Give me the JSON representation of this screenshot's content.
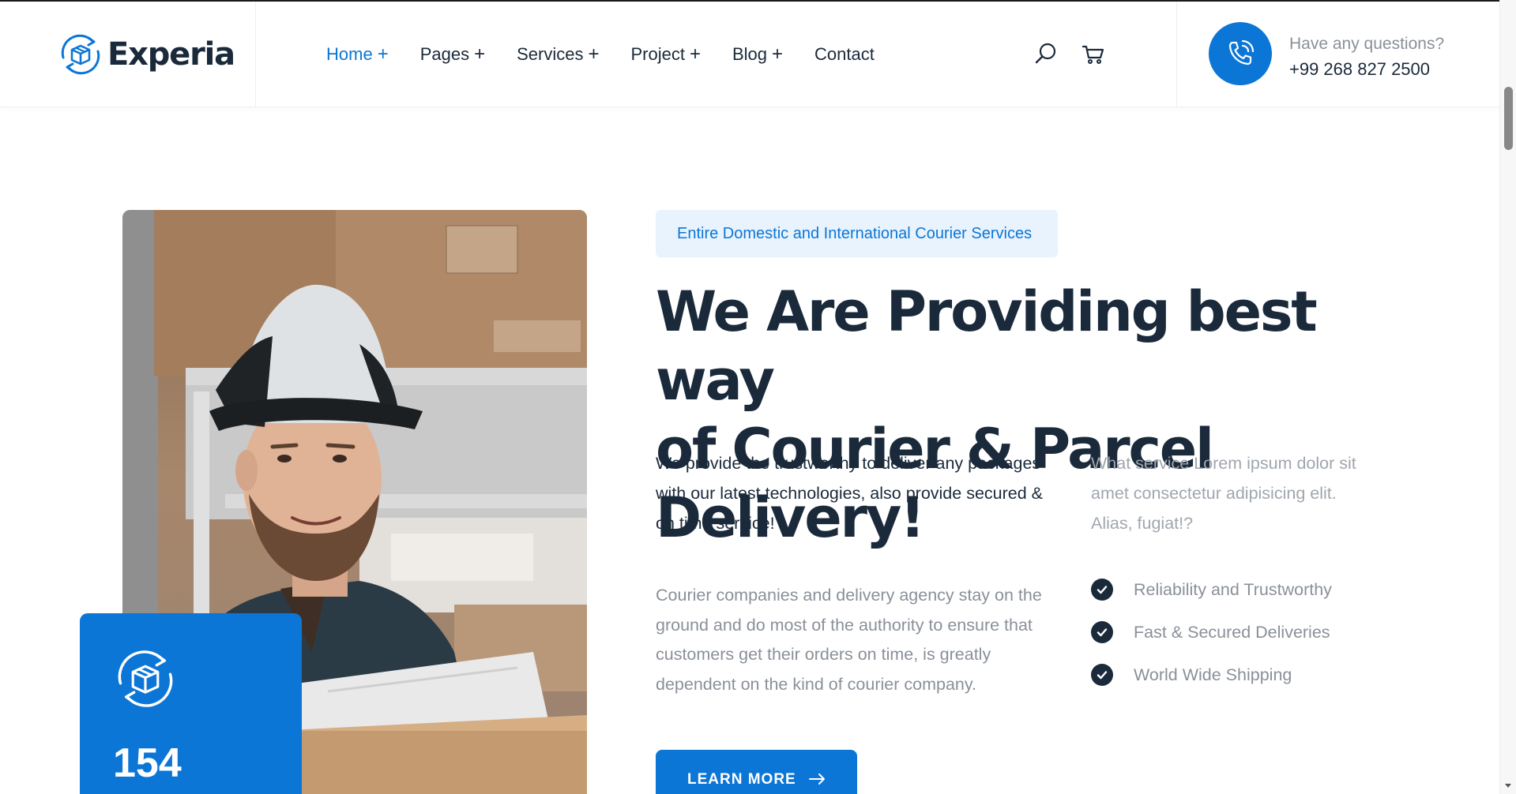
{
  "header": {
    "logo_text": "Experia",
    "nav": [
      {
        "label": "Home",
        "has_plus": true,
        "active": true
      },
      {
        "label": "Pages",
        "has_plus": true,
        "active": false
      },
      {
        "label": "Services",
        "has_plus": true,
        "active": false
      },
      {
        "label": "Project",
        "has_plus": true,
        "active": false
      },
      {
        "label": "Blog",
        "has_plus": true,
        "active": false
      },
      {
        "label": "Contact",
        "has_plus": false,
        "active": false
      }
    ],
    "plus_glyph": "+",
    "icons": [
      "search-icon",
      "cart-icon"
    ],
    "contact_question": "Have any questions?",
    "contact_phone": "+99 268 827 2500"
  },
  "hero": {
    "badge": "Entire Domestic and International Courier Services",
    "headline_line1": "We Are Providing best way",
    "headline_line2": "of Courier & Parcel Delivery!",
    "lead": "We provide the trustworthy to deliver any packages with our latest technologies, also provide secured & on time service!",
    "description": "Courier companies and delivery agency stay on the ground and do most of the authority to ensure that customers get their orders on time, is greatly dependent on the kind of courier company.",
    "side_question": "What service Lorem ipsum dolor sit amet consectetur adipisicing elit. Alias, fugiat!?",
    "checklist": [
      "Reliability and Trustworthy",
      "Fast & Secured Deliveries",
      "World Wide Shipping"
    ],
    "cta": "LEARN MORE",
    "stat_number": "154"
  },
  "colors": {
    "accent": "#0c76d6",
    "dark": "#1b2a3b",
    "muted": "#8a9099",
    "badge_bg": "#e9f3fd"
  }
}
